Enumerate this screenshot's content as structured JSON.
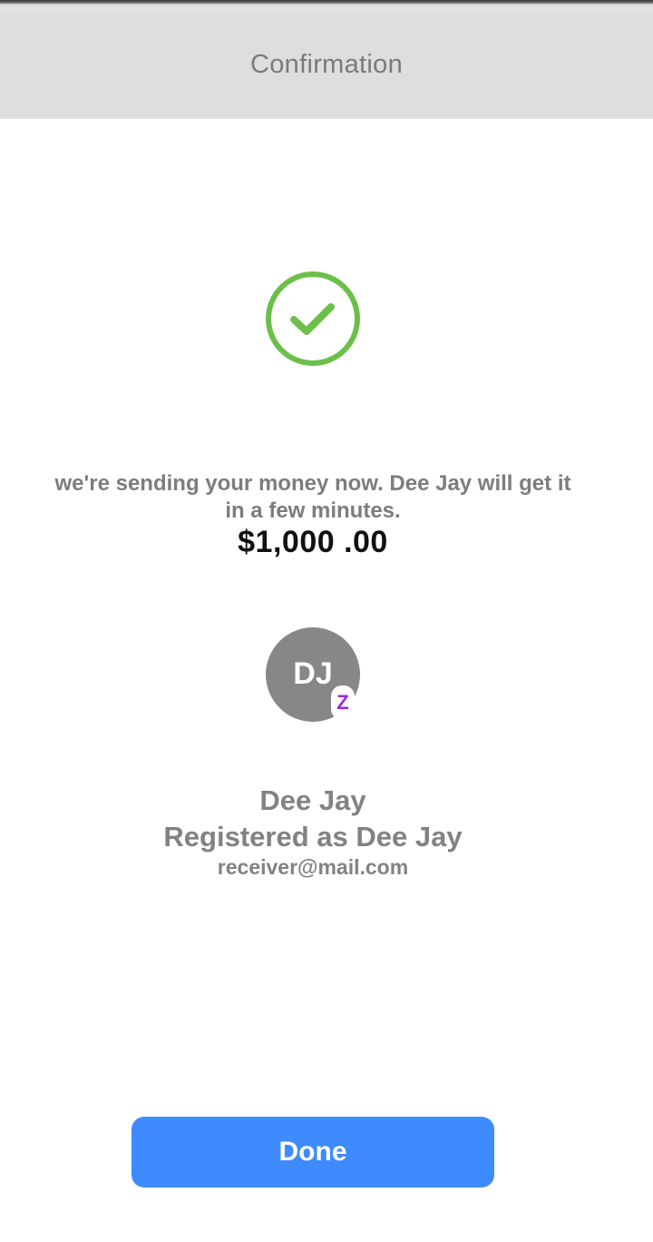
{
  "status_bar": {},
  "header": {
    "title": "Confirmation"
  },
  "confirmation": {
    "icon": "check-circle-icon",
    "icon_color": "#6cc04a",
    "message": "we're sending your money now. Dee Jay will get it in a few minutes.",
    "amount": "$1,000 .00"
  },
  "recipient": {
    "initials": "DJ",
    "badge_letter": "Z",
    "badge_icon": "zelle-icon",
    "badge_color": "#9b2ad8",
    "avatar_color": "#878787",
    "name": "Dee Jay",
    "registered_as": "Registered as Dee Jay",
    "email": "receiver@mail.com"
  },
  "actions": {
    "done_label": "Done",
    "done_color": "#3d8bff"
  }
}
